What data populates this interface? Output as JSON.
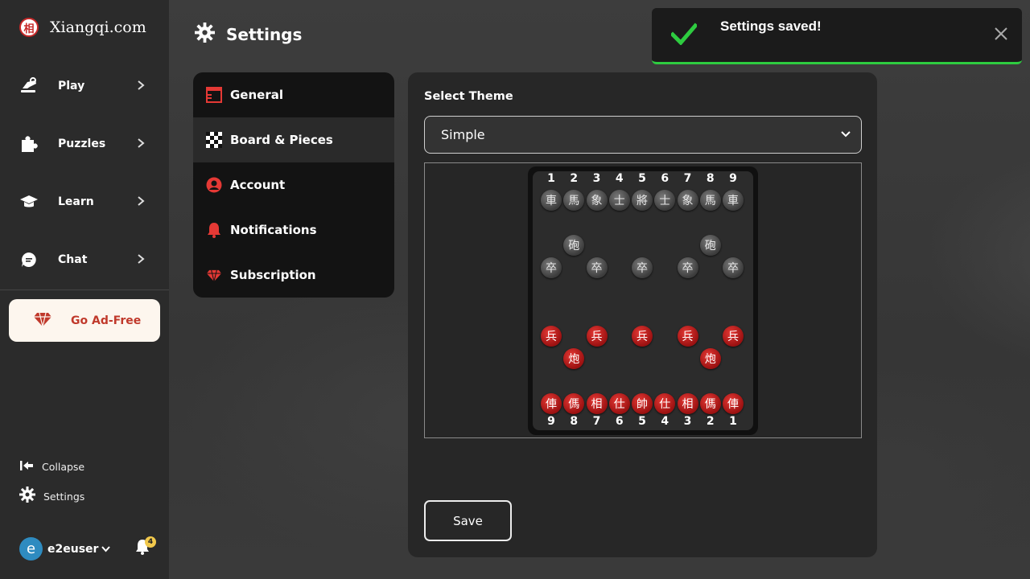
{
  "app": {
    "name": "Xiangqi.com",
    "logo_char": "相"
  },
  "sidebar": {
    "items": [
      {
        "label": "Play"
      },
      {
        "label": "Puzzles"
      },
      {
        "label": "Learn"
      },
      {
        "label": "Chat"
      }
    ],
    "ad_free_label": "Go Ad-Free",
    "collapse_label": "Collapse",
    "settings_label": "Settings",
    "user": {
      "avatar_letter": "e",
      "name": "e2euser"
    },
    "notifications_count": "4"
  },
  "header": {
    "title": "Settings"
  },
  "settings_menu": {
    "items": [
      {
        "label": "General"
      },
      {
        "label": "Board & Pieces"
      },
      {
        "label": "Account"
      },
      {
        "label": "Notifications"
      },
      {
        "label": "Subscription"
      }
    ],
    "active": "Board & Pieces"
  },
  "panel": {
    "select_label": "Select Theme",
    "theme_value": "Simple",
    "save_label": "Save"
  },
  "board": {
    "top_numbers": [
      "1",
      "2",
      "3",
      "4",
      "5",
      "6",
      "7",
      "8",
      "9"
    ],
    "bottom_numbers": [
      "9",
      "8",
      "7",
      "6",
      "5",
      "4",
      "3",
      "2",
      "1"
    ],
    "black_back": [
      "車",
      "馬",
      "象",
      "士",
      "將",
      "士",
      "象",
      "馬",
      "車"
    ],
    "black_cannon": "砲",
    "black_soldier": "卒",
    "red_back": [
      "俥",
      "傌",
      "相",
      "仕",
      "帥",
      "仕",
      "相",
      "傌",
      "俥"
    ],
    "red_cannon": "炮",
    "red_soldier": "兵"
  },
  "toast": {
    "message": "Settings saved!"
  },
  "colors": {
    "accent_red": "#c0392b",
    "success_green": "#2ecc40",
    "avatar_blue": "#2e8bc0",
    "badge_yellow": "#f2c94c"
  }
}
